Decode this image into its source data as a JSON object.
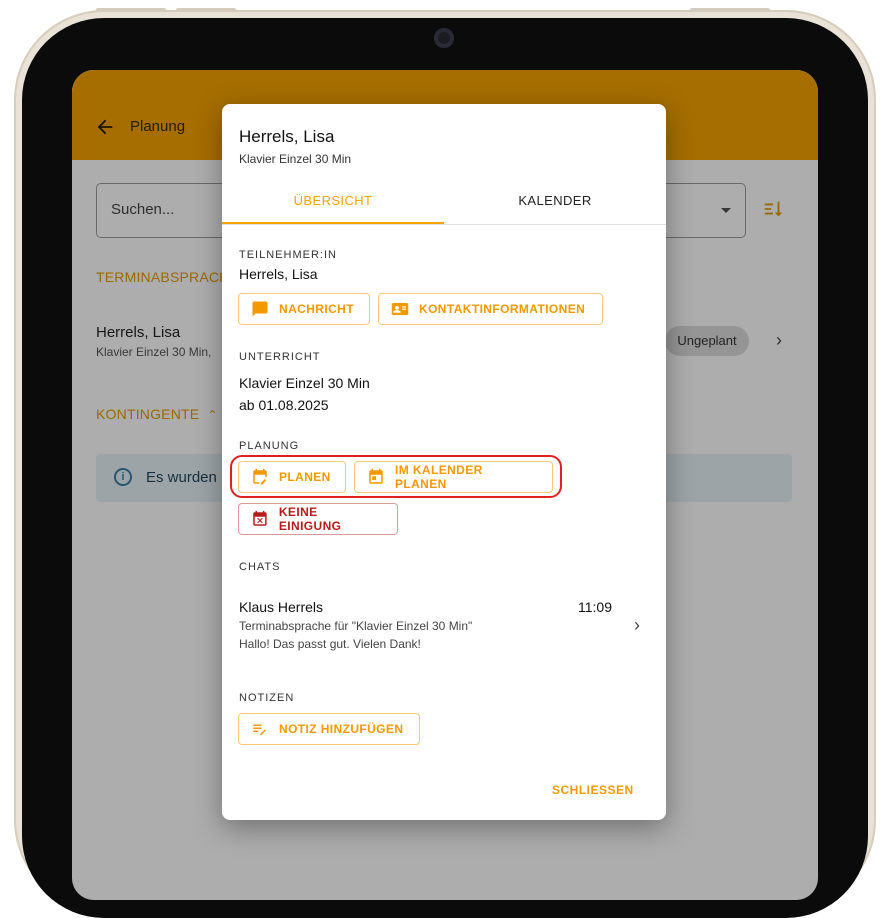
{
  "app": {
    "title": "Planung",
    "search_placeholder": "Suchen...",
    "section_terminabsprache": "TERMINABSPRACHE",
    "list_item": {
      "name": "Herrels, Lisa",
      "subtitle": "Klavier Einzel 30 Min,",
      "status": "Ungeplant"
    },
    "section_kontingente": "KONTINGENTE",
    "info_text": "Es wurden k"
  },
  "dialog": {
    "title": "Herrels, Lisa",
    "subtitle": "Klavier Einzel 30 Min",
    "tabs": [
      {
        "label": "ÜBERSICHT",
        "active": true
      },
      {
        "label": "KALENDER",
        "active": false
      }
    ],
    "teilnehmer": {
      "label": "TEILNEHMER:IN",
      "name": "Herrels, Lisa",
      "message_button": "NACHRICHT",
      "contact_button": "KONTAKTINFORMATIONEN"
    },
    "unterricht": {
      "label": "UNTERRICHT",
      "course": "Klavier Einzel 30 Min",
      "start": "ab 01.08.2025"
    },
    "planung": {
      "label": "PLANUNG",
      "plan_button": "PLANEN",
      "calendar_plan_button": "IM KALENDER PLANEN",
      "no_agreement_button": "KEINE EINIGUNG"
    },
    "chats": {
      "label": "CHATS",
      "items": [
        {
          "sender": "Klaus Herrels",
          "time": "11:09",
          "subject": "Terminabsprache für \"Klavier Einzel 30 Min\"",
          "preview": "Hallo! Das passt gut. Vielen Dank!"
        }
      ]
    },
    "notizen": {
      "label": "NOTIZEN",
      "add_button": "NOTIZ HINZUFÜGEN"
    },
    "close_button": "SCHLIESSEN"
  },
  "colors": {
    "accent": "#f5a300",
    "danger": "#b71c1c",
    "highlight": "#e02020"
  }
}
